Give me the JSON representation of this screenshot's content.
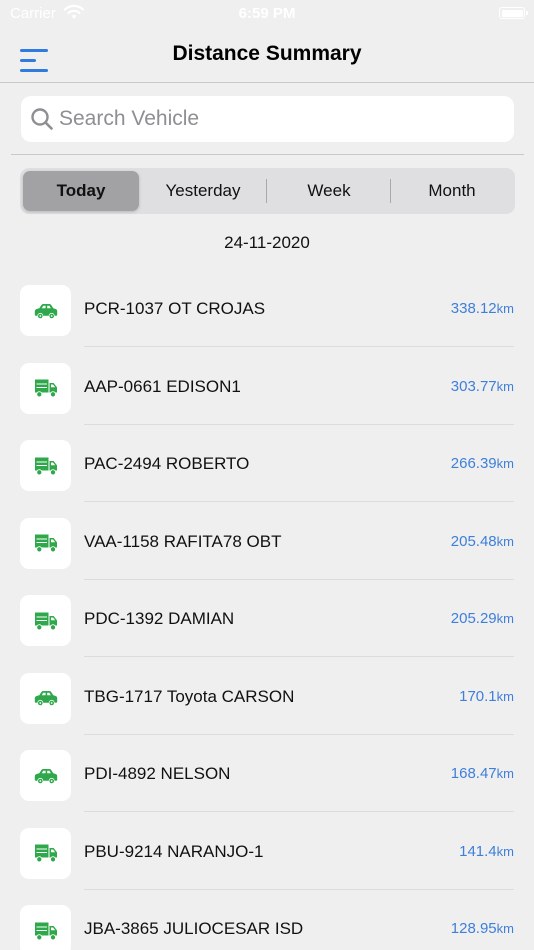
{
  "status": {
    "carrier": "Carrier",
    "time": "6:59 PM"
  },
  "nav": {
    "title": "Distance Summary"
  },
  "search": {
    "placeholder": "Search Vehicle",
    "value": ""
  },
  "segments": [
    {
      "label": "Today",
      "active": true
    },
    {
      "label": "Yesterday",
      "active": false
    },
    {
      "label": "Week",
      "active": false
    },
    {
      "label": "Month",
      "active": false
    }
  ],
  "date": "24-11-2020",
  "colors": {
    "accent": "#2f7be0",
    "vehicle_icon": "#2ea84a",
    "distance": "#3e7fd9"
  },
  "vehicles": [
    {
      "name": "PCR-1037 OT CROJAS",
      "distance": "338.12",
      "unit": "km",
      "icon": "car-icon"
    },
    {
      "name": "AAP-0661 EDISON1",
      "distance": "303.77",
      "unit": "km",
      "icon": "truck-icon"
    },
    {
      "name": "PAC-2494 ROBERTO",
      "distance": "266.39",
      "unit": "km",
      "icon": "truck-icon"
    },
    {
      "name": "VAA-1158 RAFITA78 OBT",
      "distance": "205.48",
      "unit": "km",
      "icon": "truck-icon"
    },
    {
      "name": "PDC-1392 DAMIAN",
      "distance": "205.29",
      "unit": "km",
      "icon": "truck-icon"
    },
    {
      "name": "TBG-1717 Toyota CARSON",
      "distance": "170.1",
      "unit": "km",
      "icon": "car-icon"
    },
    {
      "name": "PDI-4892 NELSON",
      "distance": "168.47",
      "unit": "km",
      "icon": "car-icon"
    },
    {
      "name": "PBU-9214 NARANJO-1",
      "distance": "141.4",
      "unit": "km",
      "icon": "truck-icon"
    },
    {
      "name": "JBA-3865 JULIOCESAR ISD",
      "distance": "128.95",
      "unit": "km",
      "icon": "truck-icon"
    }
  ]
}
